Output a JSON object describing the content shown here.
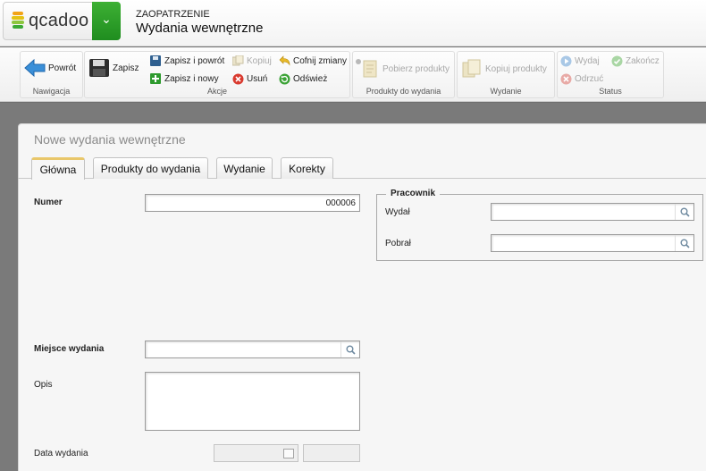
{
  "header": {
    "logo": "qcadoo",
    "category": "ZAOPATRZENIE",
    "title": "Wydania wewnętrzne"
  },
  "ribbon": {
    "groups": {
      "navigation": "Nawigacja",
      "actions": "Akcje",
      "products": "Produkty do wydania",
      "issue": "Wydanie",
      "status": "Status"
    },
    "buttons": {
      "back": "Powrót",
      "save": "Zapisz",
      "save_back": "Zapisz i powrót",
      "save_new": "Zapisz i nowy",
      "copy": "Kopiuj",
      "delete": "Usuń",
      "undo": "Cofnij zmiany",
      "refresh": "Odśwież",
      "fetch_products": "Pobierz produkty",
      "copy_products": "Kopiuj produkty",
      "issue": "Wydaj",
      "reject": "Odrzuć",
      "finish": "Zakończ"
    }
  },
  "form": {
    "title": "Nowe wydania wewnętrzne",
    "tabs": [
      "Główna",
      "Produkty do wydania",
      "Wydanie",
      "Korekty"
    ],
    "number_label": "Numer",
    "number_value": "000006",
    "employee_legend": "Pracownik",
    "issued_by_label": "Wydał",
    "received_by_label": "Pobrał",
    "place_label": "Miejsce wydania",
    "description_label": "Opis",
    "date_label": "Data wydania"
  },
  "colors": {
    "accent_green": "#2a9e26",
    "tab_active_border": "#e9c76a"
  }
}
